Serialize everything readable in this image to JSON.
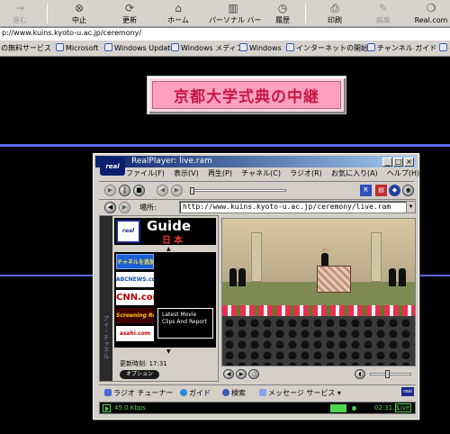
{
  "ie_toolbar": {
    "buttons": [
      {
        "label": "進む",
        "icon": "forward-arrow-icon",
        "disabled": true
      },
      {
        "label": "中止",
        "icon": "stop-icon",
        "disabled": false
      },
      {
        "label": "更新",
        "icon": "refresh-icon",
        "disabled": false
      },
      {
        "label": "ホーム",
        "icon": "home-icon",
        "disabled": false
      },
      {
        "label": "パーソナル バー",
        "icon": "personal-bar-icon",
        "disabled": false
      },
      {
        "label": "履歴",
        "icon": "history-icon",
        "disabled": false
      },
      {
        "label": "印刷",
        "icon": "print-icon",
        "disabled": false
      },
      {
        "label": "編集",
        "icon": "edit-icon",
        "disabled": true
      },
      {
        "label": "Real.com",
        "icon": "real-com-icon",
        "disabled": false
      }
    ]
  },
  "address": {
    "url": "p://www.kuins.kyoto-u.ac.jp/ceremony/"
  },
  "links_bar": {
    "items": [
      "の無料サービス",
      "Microsoft",
      "Windows Update",
      "Windows メディア",
      "Windows",
      "インターネットの開始",
      "チャンネル ガイド",
      "ベ"
    ]
  },
  "page": {
    "title": "京都大学式典の中継"
  },
  "realplayer": {
    "window_title": "RealPlayer: live.ram",
    "logo_text": "real",
    "menu": [
      "ファイル(F)",
      "表示(V)",
      "再生(P)",
      "チャネル(C)",
      "ラジオ(R)",
      "お気に入り(A)",
      "ヘルプ(H)"
    ],
    "location_label": "場所:",
    "location_url": "http://www.kuins.kyoto-u.ac.jp/ceremony/live.ram",
    "guide": {
      "title": "Guide",
      "subtitle": "日本",
      "side_label": "アイ・チャネル",
      "items": [
        "チャネルを追加する",
        "ABCNEWS.com",
        "CNN.com",
        "Screening Room",
        "asahi.com"
      ],
      "promo_text": "Latest Movie Clips And Report",
      "updated": "更新時刻: 17:31",
      "options_label": "オプション"
    },
    "bottom_links": [
      "ラジオ チューナー",
      "ガイド",
      "検索",
      "メッセージ サービス"
    ],
    "status": {
      "bitrate": "45.0 Kbps",
      "time": "02:31.5",
      "live": "Live"
    }
  },
  "colors": {
    "title_text": "#c41a48",
    "title_bg": "#ff9fbf",
    "accent_line": "#5a6de8",
    "status_green": "#4fd44f"
  }
}
